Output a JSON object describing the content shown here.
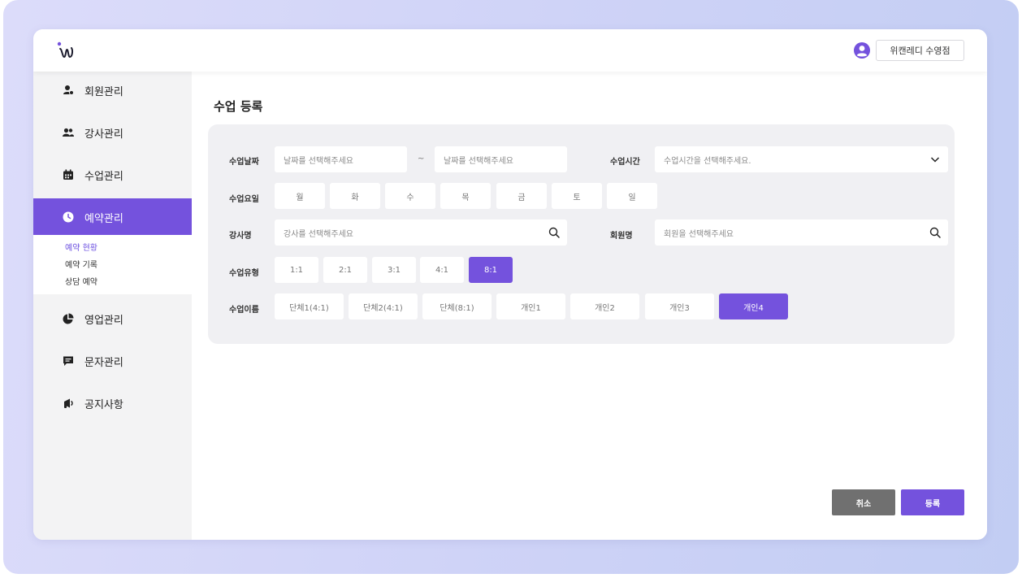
{
  "header": {
    "store_label": "위캔레디 수영점"
  },
  "sidebar": {
    "items": [
      {
        "label": "회원관리",
        "icon": "member-icon"
      },
      {
        "label": "강사관리",
        "icon": "people-icon"
      },
      {
        "label": "수업관리",
        "icon": "calendar-icon"
      },
      {
        "label": "예약관리",
        "icon": "clock-icon"
      },
      {
        "label": "영업관리",
        "icon": "pie-chart-icon"
      },
      {
        "label": "문자관리",
        "icon": "message-icon"
      },
      {
        "label": "공지사항",
        "icon": "megaphone-icon"
      }
    ],
    "subitems": [
      "예약 현황",
      "예약 기록",
      "상담 예약"
    ]
  },
  "page": {
    "title": "수업 등록"
  },
  "form": {
    "date_label": "수업날짜",
    "date_start_placeholder": "날짜를 선택해주세요",
    "date_separator": "~",
    "date_end_placeholder": "날짜를 선택해주세요",
    "time_label": "수업시간",
    "time_placeholder": "수업시간을 선택해주세요.",
    "day_label": "수업요일",
    "days": [
      "월",
      "화",
      "수",
      "목",
      "금",
      "토",
      "일"
    ],
    "instructor_label": "강사명",
    "instructor_placeholder": "강사를 선택해주세요",
    "member_label": "회원명",
    "member_placeholder": "회원을 선택해주세요",
    "type_label": "수업유형",
    "types": [
      "1:1",
      "2:1",
      "3:1",
      "4:1",
      "8:1"
    ],
    "type_selected": "8:1",
    "name_label": "수업이름",
    "names": [
      "단체1(4:1)",
      "단체2(4:1)",
      "단체(8:1)",
      "개인1",
      "개인2",
      "개인3",
      "개인4"
    ],
    "name_selected": "개인4"
  },
  "actions": {
    "cancel_label": "취소",
    "submit_label": "등록"
  },
  "colors": {
    "accent": "#7452dd",
    "cancel": "#707070",
    "form_bg": "#f0f0f3",
    "sidebar_bg": "#f3f3f4"
  }
}
